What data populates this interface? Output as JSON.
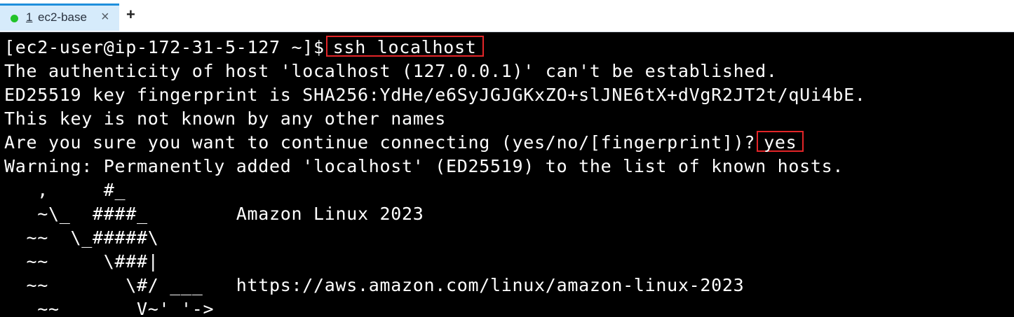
{
  "tab": {
    "index": "1",
    "title": "ec2-base",
    "close_icon": "×",
    "new_tab_icon": "+",
    "status_color": "#22c32a"
  },
  "terminal": {
    "prompt": "[ec2-user@ip-172-31-5-127 ~]$",
    "command": "ssh localhost",
    "line_auth": "The authenticity of host 'localhost (127.0.0.1)' can't be established.",
    "line_fingerprint": "ED25519 key fingerprint is SHA256:YdHe/e6SyJGJGKxZO+slJNE6tX+dVgR2JT2t/qUi4bE.",
    "line_not_known": "This key is not known by any other names",
    "confirm_question": "Are you sure you want to continue connecting (yes/no/[fingerprint])?",
    "confirm_answer": "yes",
    "line_warning": "Warning: Permanently added 'localhost' (ED25519) to the list of known hosts.",
    "logo_1": "   ,     #_",
    "logo_2": "   ~\\_  ####_        Amazon Linux 2023",
    "logo_3": "  ~~  \\_#####\\",
    "logo_4": "  ~~     \\###|",
    "logo_5": "  ~~       \\#/ ___   https://aws.amazon.com/linux/amazon-linux-2023",
    "logo_6": "   ~~       V~' '->",
    "highlight_color": "#e22528"
  }
}
